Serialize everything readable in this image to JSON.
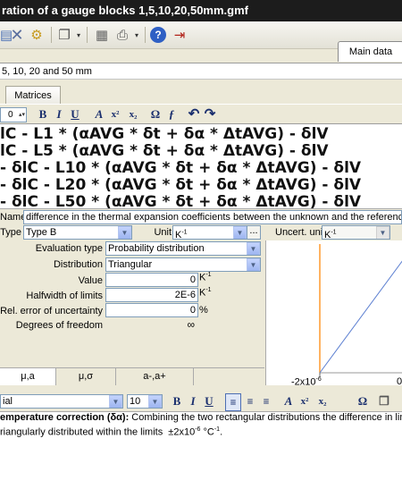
{
  "window": {
    "title": "ration of a gauge blocks 1,5,10,20,50mm.gmf"
  },
  "toolbar": {
    "tab_main_data": "Main data"
  },
  "subtitle": "5, 10, 20 and 50 mm",
  "tabs": {
    "matrices": "Matrices"
  },
  "formula_toolbar": {
    "font_size": "0",
    "bold": "B",
    "italic": "I",
    "underline": "U",
    "a": "A",
    "sup": "x²",
    "sub": "x₂",
    "omega": "Ω",
    "f": "ƒ"
  },
  "formula_lines": [
    "lC - L1 * (αAVG * δt + δα * ΔtAVG) - δlV",
    "lC - L5 * (αAVG * δt + δα * ΔtAVG) - δlV",
    "- δlC - L10 * (αAVG * δt + δα * ΔtAVG) - δlV",
    "- δlC - L20 * (αAVG * δt + δα * ΔtAVG) - δlV",
    "- δlC - L50 * (αAVG * δt + δα * ΔtAVG) - δlV"
  ],
  "props": {
    "name_label": "Name",
    "name_value": "difference in the thermal expansion coefficients between the unknown and the reference gauge block.",
    "type_label": "Type",
    "type_value": "Type B",
    "unit_label": "Unit",
    "unit_value": "K-1",
    "unit_btn": "...",
    "uncert_unit_label": "Uncert. unit",
    "uncert_unit_value": "K-1"
  },
  "eval": {
    "evaluation_type_label": "Evaluation type",
    "evaluation_type_value": "Probability distribution",
    "distribution_label": "Distribution",
    "distribution_value": "Triangular",
    "value_label": "Value",
    "value_value": "0",
    "value_unit": "K-1",
    "halfwidth_label": "Halfwidth of limits",
    "halfwidth_value": "2E-6",
    "halfwidth_unit": "K-1",
    "rel_error_label": "Rel. error of uncertainty",
    "rel_error_value": "0",
    "rel_error_unit": "%",
    "dof_label": "Degrees of freedom",
    "dof_value": "∞"
  },
  "subtabs": [
    "μ,a",
    "μ,σ",
    "a-,a+"
  ],
  "chart": {
    "tick_left": "-2x10-6",
    "tick_right": "0"
  },
  "text_toolbar": {
    "font_name": "ial",
    "font_size": "10"
  },
  "text_body": {
    "heading": "emperature correction (δα):",
    "line1": " Combining the two rectangular distributions the difference in line",
    "line2": "riangularly distributed within the limits  ±2x10-6 °C-1."
  }
}
